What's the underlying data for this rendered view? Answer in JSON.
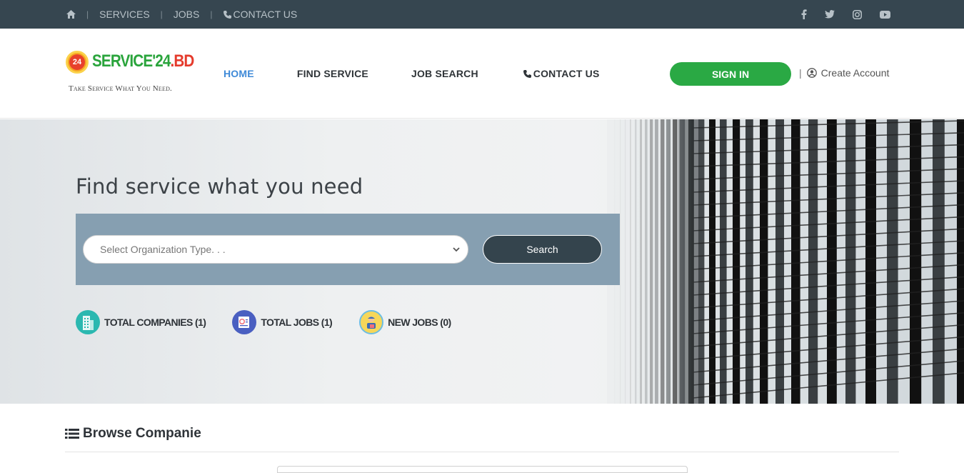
{
  "topbar": {
    "links": [
      "SERVICES",
      "JOBS",
      "CONTACT US"
    ],
    "social": [
      "facebook-icon",
      "twitter-icon",
      "instagram-icon",
      "youtube-icon"
    ]
  },
  "logo": {
    "badge_number": "24",
    "brand_main": "SERVICE'24",
    "brand_suffix": ".BD",
    "tagline": "Take Service What You Need."
  },
  "nav": {
    "items": [
      "HOME",
      "FIND SERVICE",
      "JOB SEARCH",
      "CONTACT US"
    ],
    "active": "HOME"
  },
  "auth": {
    "signin_label": "SIGN IN",
    "create_account_label": "Create Account"
  },
  "hero": {
    "title": "Find service what you need",
    "select_placeholder": "Select Organization Type. . .",
    "search_label": "Search",
    "stats": [
      {
        "label": "TOTAL COMPANIES (1)"
      },
      {
        "label": "TOTAL JOBS (1)"
      },
      {
        "label": "NEW JOBS (0)"
      }
    ]
  },
  "browse": {
    "title": "Browse Companie"
  },
  "colors": {
    "topbar": "#364650",
    "accent_green": "#2aa944",
    "nav_active": "#3f8ad8",
    "panel": "#869fb1",
    "search_button": "#34444d"
  }
}
